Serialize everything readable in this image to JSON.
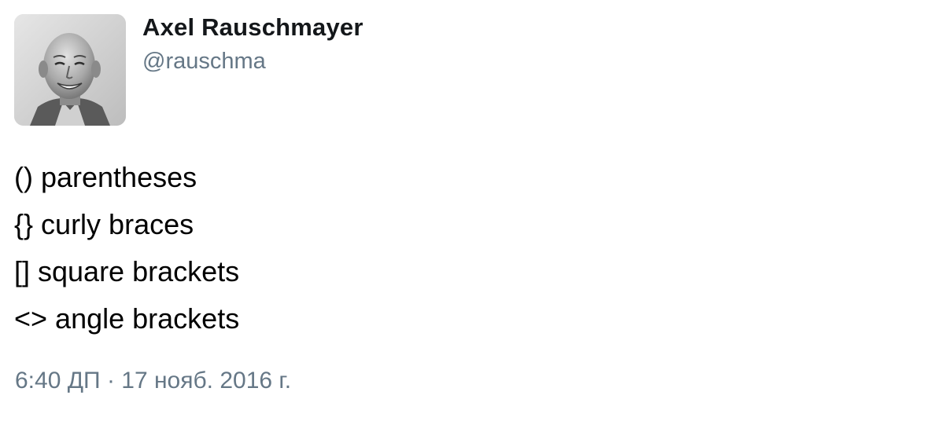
{
  "author": {
    "display_name": "Axel Rauschmayer",
    "handle": "@rauschma"
  },
  "tweet": {
    "lines": [
      "() parentheses",
      "{} curly braces",
      "[] square brackets",
      "<> angle brackets"
    ],
    "time": "6:40 ДП",
    "separator": " · ",
    "date": "17 нояб. 2016 г."
  },
  "colors": {
    "text": "#000000",
    "name": "#14171a",
    "muted": "#657786"
  }
}
